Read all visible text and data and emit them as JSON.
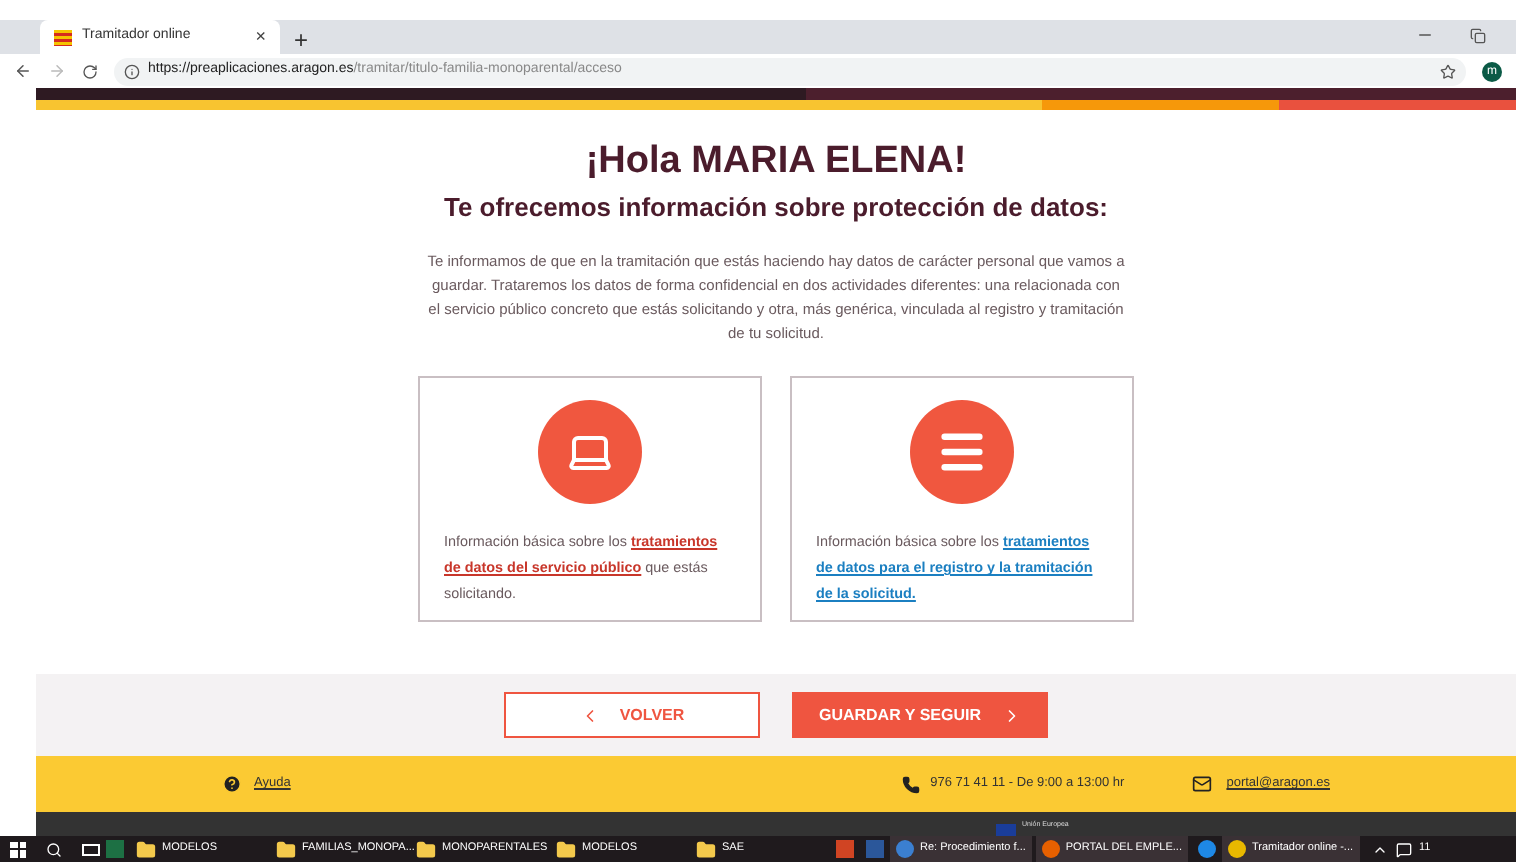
{
  "browser": {
    "tab_title": "Tramitador online",
    "tab_close": "×",
    "new_tab": "+",
    "url_host": "https://preaplicaciones.aragon.es",
    "url_path": "/tramitar/titulo-familia-monoparental/acceso",
    "profile": "m"
  },
  "page": {
    "greeting": "¡Hola MARIA ELENA!",
    "subtitle": "Te ofrecemos información sobre protección de datos:",
    "intro": "Te informamos de que en la tramitación que estás haciendo hay datos de carácter personal que vamos a guardar. Trataremos los datos de forma confidencial en dos actividades diferentes: una relacionada con el servicio público concreto que estás solicitando y otra, más genérica, vinculada al registro y tramitación de tu solicitud.",
    "cards": [
      {
        "kind": "laptop",
        "text": "Información básica sobre los **tratamientos de datos del servicio público** que estás solicitando.",
        "color": "#c8362a"
      },
      {
        "kind": "menu",
        "text": "Información básica sobre los **tratamientos de datos para el registro y la tramitación de la solicitud.**",
        "color": "#1b7fc1"
      }
    ]
  },
  "actions": {
    "back": "VOLVER",
    "next": "GUARDAR Y SEGUIR"
  },
  "footer": {
    "help": "Ayuda",
    "phone": "976 71 41 11 - De 9:00 a 13:00 hr",
    "email": "portal@aragon.es",
    "eu": "Unión Europea"
  },
  "taskbar": [
    {
      "kind": "excel"
    },
    {
      "kind": "folder",
      "label": "MODELOS"
    },
    {
      "kind": "folder",
      "label": "FAMILIAS_MONOPA..."
    },
    {
      "kind": "folder",
      "label": "MONOPARENTALES"
    },
    {
      "kind": "folder",
      "label": "MODELOS"
    },
    {
      "kind": "folder",
      "label": "SAE"
    },
    {
      "kind": "ppt"
    },
    {
      "kind": "word"
    },
    {
      "kind": "mail",
      "label": "Re: Procedimiento f..."
    },
    {
      "kind": "firefox",
      "label": "PORTAL DEL EMPLE..."
    },
    {
      "kind": "ie"
    },
    {
      "kind": "chrome",
      "label": "Tramitador online -..."
    }
  ],
  "clock": "11"
}
